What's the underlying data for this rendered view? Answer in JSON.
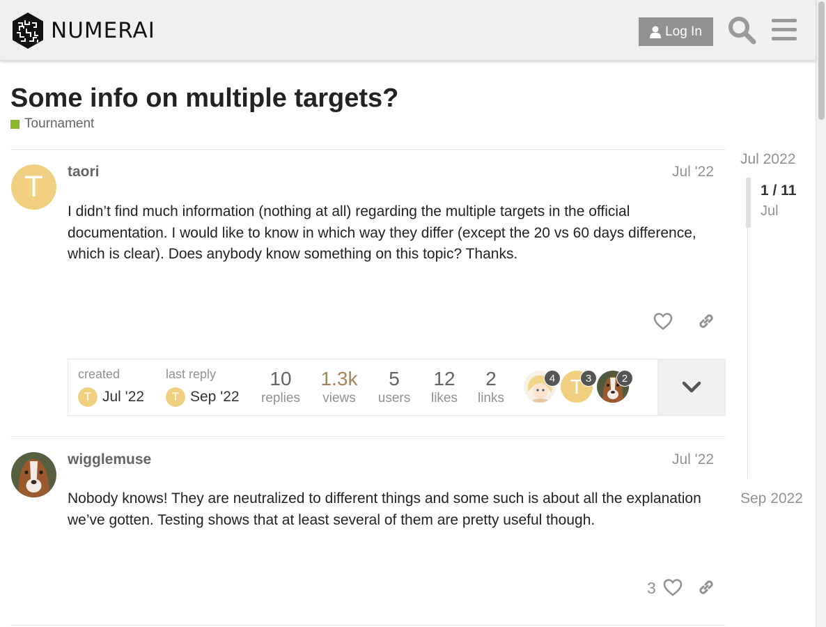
{
  "header": {
    "logo_text": "NUMERAI",
    "login_label": "Log In"
  },
  "topic": {
    "title": "Some info on multiple targets?",
    "category": "Tournament",
    "category_color": "#8db82d"
  },
  "posts": [
    {
      "username": "taori",
      "date": "Jul '22",
      "avatar_letter": "T",
      "body": "I didn’t find much information (nothing at all) regarding the multiple targets in the official documentation. I would like to know in which way they differ (except the 20 vs 60 days difference, which is clear). Does anybody know something on this topic? Thanks."
    },
    {
      "username": "wigglemuse",
      "date": "Jul '22",
      "body": "Nobody knows! They are neutralized to different things and some such is about all the explanation we’ve gotten. Testing shows that at least several of them are pretty useful though.",
      "likes": "3"
    }
  ],
  "topic_map": {
    "created_label": "created",
    "created_date": "Jul '22",
    "last_reply_label": "last reply",
    "last_reply_date": "Sep '22",
    "avatar_letter": "T",
    "stats": [
      {
        "num": "10",
        "label": "replies"
      },
      {
        "num": "1.3k",
        "label": "views"
      },
      {
        "num": "5",
        "label": "users"
      },
      {
        "num": "12",
        "label": "likes"
      },
      {
        "num": "2",
        "label": "links"
      }
    ],
    "participants": [
      {
        "count": "4"
      },
      {
        "count": "3",
        "letter": "T"
      },
      {
        "count": "2"
      }
    ]
  },
  "timeline": {
    "top_date": "Jul 2022",
    "position": "1 / 11",
    "month": "Jul",
    "bottom_date": "Sep 2022"
  }
}
